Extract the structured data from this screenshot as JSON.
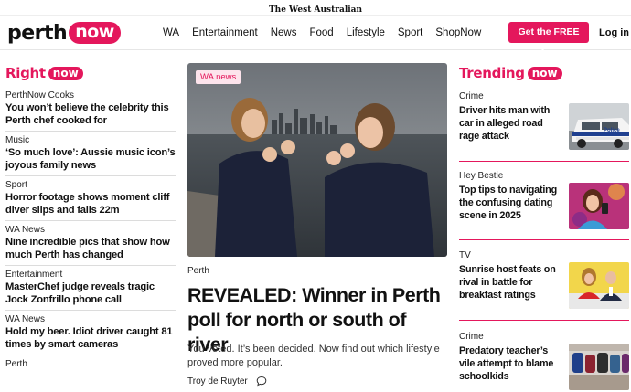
{
  "masthead": {
    "text": "The West Australian"
  },
  "logo": {
    "perth": "perth",
    "now": "now"
  },
  "nav": {
    "items": [
      "WA",
      "Entertainment",
      "News",
      "Food",
      "Lifestyle",
      "Sport",
      "ShopNow"
    ],
    "app_button": "Get the FREE App",
    "login": "Log in"
  },
  "left": {
    "title": "Right",
    "now": "now",
    "items": [
      {
        "kicker": "PerthNow Cooks",
        "headline": "You won’t believe the celebrity this Perth chef cooked for"
      },
      {
        "kicker": "Music",
        "headline": "‘So much love’: Aussie music icon’s joyous family news"
      },
      {
        "kicker": "Sport",
        "headline": "Horror footage shows moment cliff diver slips and falls 22m"
      },
      {
        "kicker": "WA News",
        "headline": "Nine incredible pics that show how much Perth has changed"
      },
      {
        "kicker": "Entertainment",
        "headline": "MasterChef judge reveals tragic Jock Zonfrillo phone call"
      },
      {
        "kicker": "WA News",
        "headline": "Hold my beer. Idiot driver caught 81 times by smart cameras"
      },
      {
        "kicker": "Perth",
        "headline": ""
      }
    ]
  },
  "feature": {
    "tag": "WA news",
    "kicker": "Perth",
    "headline": "REVEALED: Winner in Perth poll for north or south of river",
    "summary": "You voted. It’s been decided. Now find out which lifestyle proved more popular.",
    "author": "Troy de Ruyter"
  },
  "trending": {
    "title": "Trending",
    "now": "now",
    "items": [
      {
        "kicker": "Crime",
        "headline": "Driver hits man with car in alleged road rage attack",
        "thumb": "police-car-image"
      },
      {
        "kicker": "Hey Bestie",
        "headline": "Top tips to navigating the confusing dating scene in 2025",
        "thumb": "woman-phone-image"
      },
      {
        "kicker": "TV",
        "headline": "Sunrise host feats on rival in battle for breakfast ratings",
        "thumb": "tv-hosts-image"
      },
      {
        "kicker": "Crime",
        "headline": "Predatory teacher’s vile attempt to blame schoolkids",
        "thumb": "school-bags-image"
      }
    ]
  },
  "colors": {
    "accent": "#e4175c"
  }
}
